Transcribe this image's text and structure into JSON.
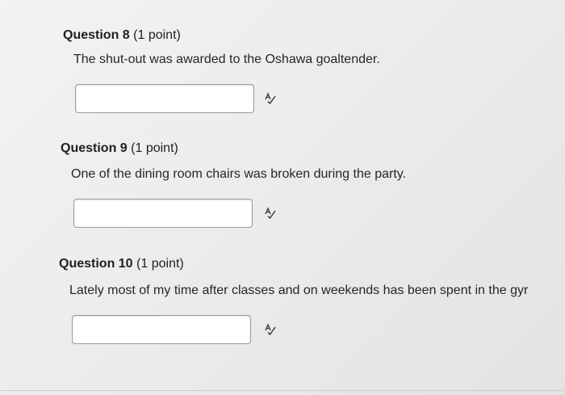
{
  "questions": [
    {
      "number": "Question 8",
      "points": "(1 point)",
      "text": "The shut-out was awarded to the Oshawa goaltender.",
      "answer_value": "",
      "spell_icon": "spell-check-icon"
    },
    {
      "number": "Question 9",
      "points": "(1 point)",
      "text": "One of the dining room chairs was broken during the party.",
      "answer_value": "",
      "spell_icon": "spell-check-icon"
    },
    {
      "number": "Question 10",
      "points": "(1 point)",
      "text": "Lately most of my time after classes and on weekends has been spent in the gyr",
      "answer_value": "",
      "spell_icon": "spell-check-icon"
    }
  ]
}
